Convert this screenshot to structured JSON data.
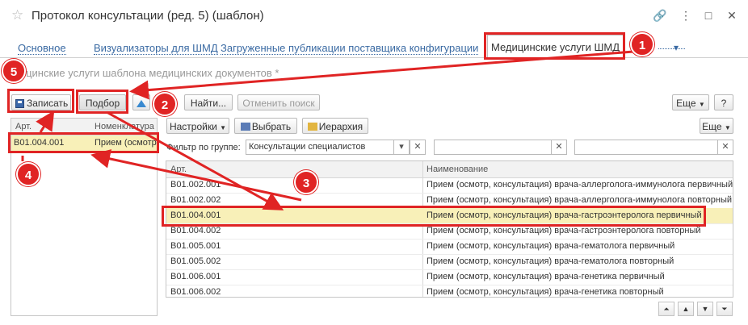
{
  "window": {
    "title": "Протокол консультации (ред. 5) (шаблон)",
    "controls": [
      "🔗",
      "⋮",
      "□",
      "✕"
    ]
  },
  "tabs": [
    {
      "label": "Основное"
    },
    {
      "label": "Визуализаторы для ШМД"
    },
    {
      "label": "Загруженные публикации поставщика конфигурации"
    },
    {
      "label": "Медицинские услуги ШМД"
    }
  ],
  "tabs_more": "▾",
  "subtitle": "...ицинские услуги шаблона медицинских документов *",
  "toolbar": {
    "save": "Записать",
    "pick": "Подбор",
    "find": "Найти...",
    "cancel_search": "Отменить поиск",
    "more": "Еще",
    "help": "?"
  },
  "left_table": {
    "columns": [
      "Арт.",
      "Номенклатура"
    ],
    "rows": [
      {
        "art": "B01.004.001",
        "name": "Прием (осмотр, консультация) врача-гастроэнтеролога первичный"
      }
    ]
  },
  "right_toolbar": {
    "settings": "Настройки",
    "select": "Выбрать",
    "hierarchy": "Иерархия",
    "more": "Еще"
  },
  "filter": {
    "label": "Фильтр по группе:",
    "value": "Консультации специалистов"
  },
  "right_table": {
    "columns": [
      "Арт.",
      "Наименование"
    ],
    "rows": [
      {
        "art": "B01.002.001",
        "name": "Прием (осмотр, консультация) врача-аллерголога-иммунолога первичный"
      },
      {
        "art": "B01.002.002",
        "name": "Прием (осмотр, консультация) врача-аллерголога-иммунолога повторный"
      },
      {
        "art": "B01.004.001",
        "name": "Прием (осмотр, консультация) врача-гастроэнтеролога первичный"
      },
      {
        "art": "B01.004.002",
        "name": "Прием (осмотр, консультация) врача-гастроэнтеролога повторный"
      },
      {
        "art": "B01.005.001",
        "name": "Прием (осмотр, консультация) врача-гематолога первичный"
      },
      {
        "art": "B01.005.002",
        "name": "Прием (осмотр, консультация) врача-гематолога повторный"
      },
      {
        "art": "B01.006.001",
        "name": "Прием (осмотр, консультация) врача-генетика первичный"
      },
      {
        "art": "B01.006.002",
        "name": "Прием (осмотр, консультация) врача-генетика повторный"
      }
    ]
  },
  "nav_buttons": [
    "⏶",
    "▲",
    "▼",
    "⏷"
  ],
  "annotations": [
    "1",
    "2",
    "3",
    "4",
    "5"
  ],
  "colors": {
    "accent_red": "#e02424",
    "selection": "#f8f0b8",
    "link": "#3a6aa3"
  },
  "icons": [
    "star-icon",
    "link-icon",
    "more-icon",
    "maximize-icon",
    "close-icon",
    "save-icon",
    "up-arrow-icon",
    "select-icon",
    "hierarchy-icon",
    "dropdown-icon",
    "clear-icon"
  ]
}
